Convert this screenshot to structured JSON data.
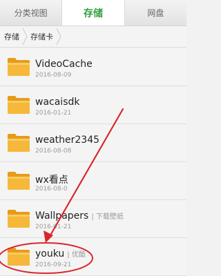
{
  "tabs": [
    {
      "label": "分类视图",
      "active": false
    },
    {
      "label": "存储",
      "active": true
    },
    {
      "label": "网盘",
      "active": false
    }
  ],
  "breadcrumb": [
    "存储",
    "存储卡"
  ],
  "folders": [
    {
      "name": "VideoCache",
      "alias": "",
      "date": "2016-08-09"
    },
    {
      "name": "wacaisdk",
      "alias": "",
      "date": "2016-01-21"
    },
    {
      "name": "weather2345",
      "alias": "",
      "date": "2016-08-08"
    },
    {
      "name": "wx看点",
      "alias": "",
      "date": "2016-08-0"
    },
    {
      "name": "Wallpapers",
      "alias": "| 下载壁纸",
      "date": "2016-01-21"
    },
    {
      "name": "youku",
      "alias": "| 优酷",
      "date": "2016-09-21"
    }
  ],
  "colors": {
    "accent": "#2e9e3d",
    "folder": "#f2b233",
    "annotation": "#d9262b"
  }
}
